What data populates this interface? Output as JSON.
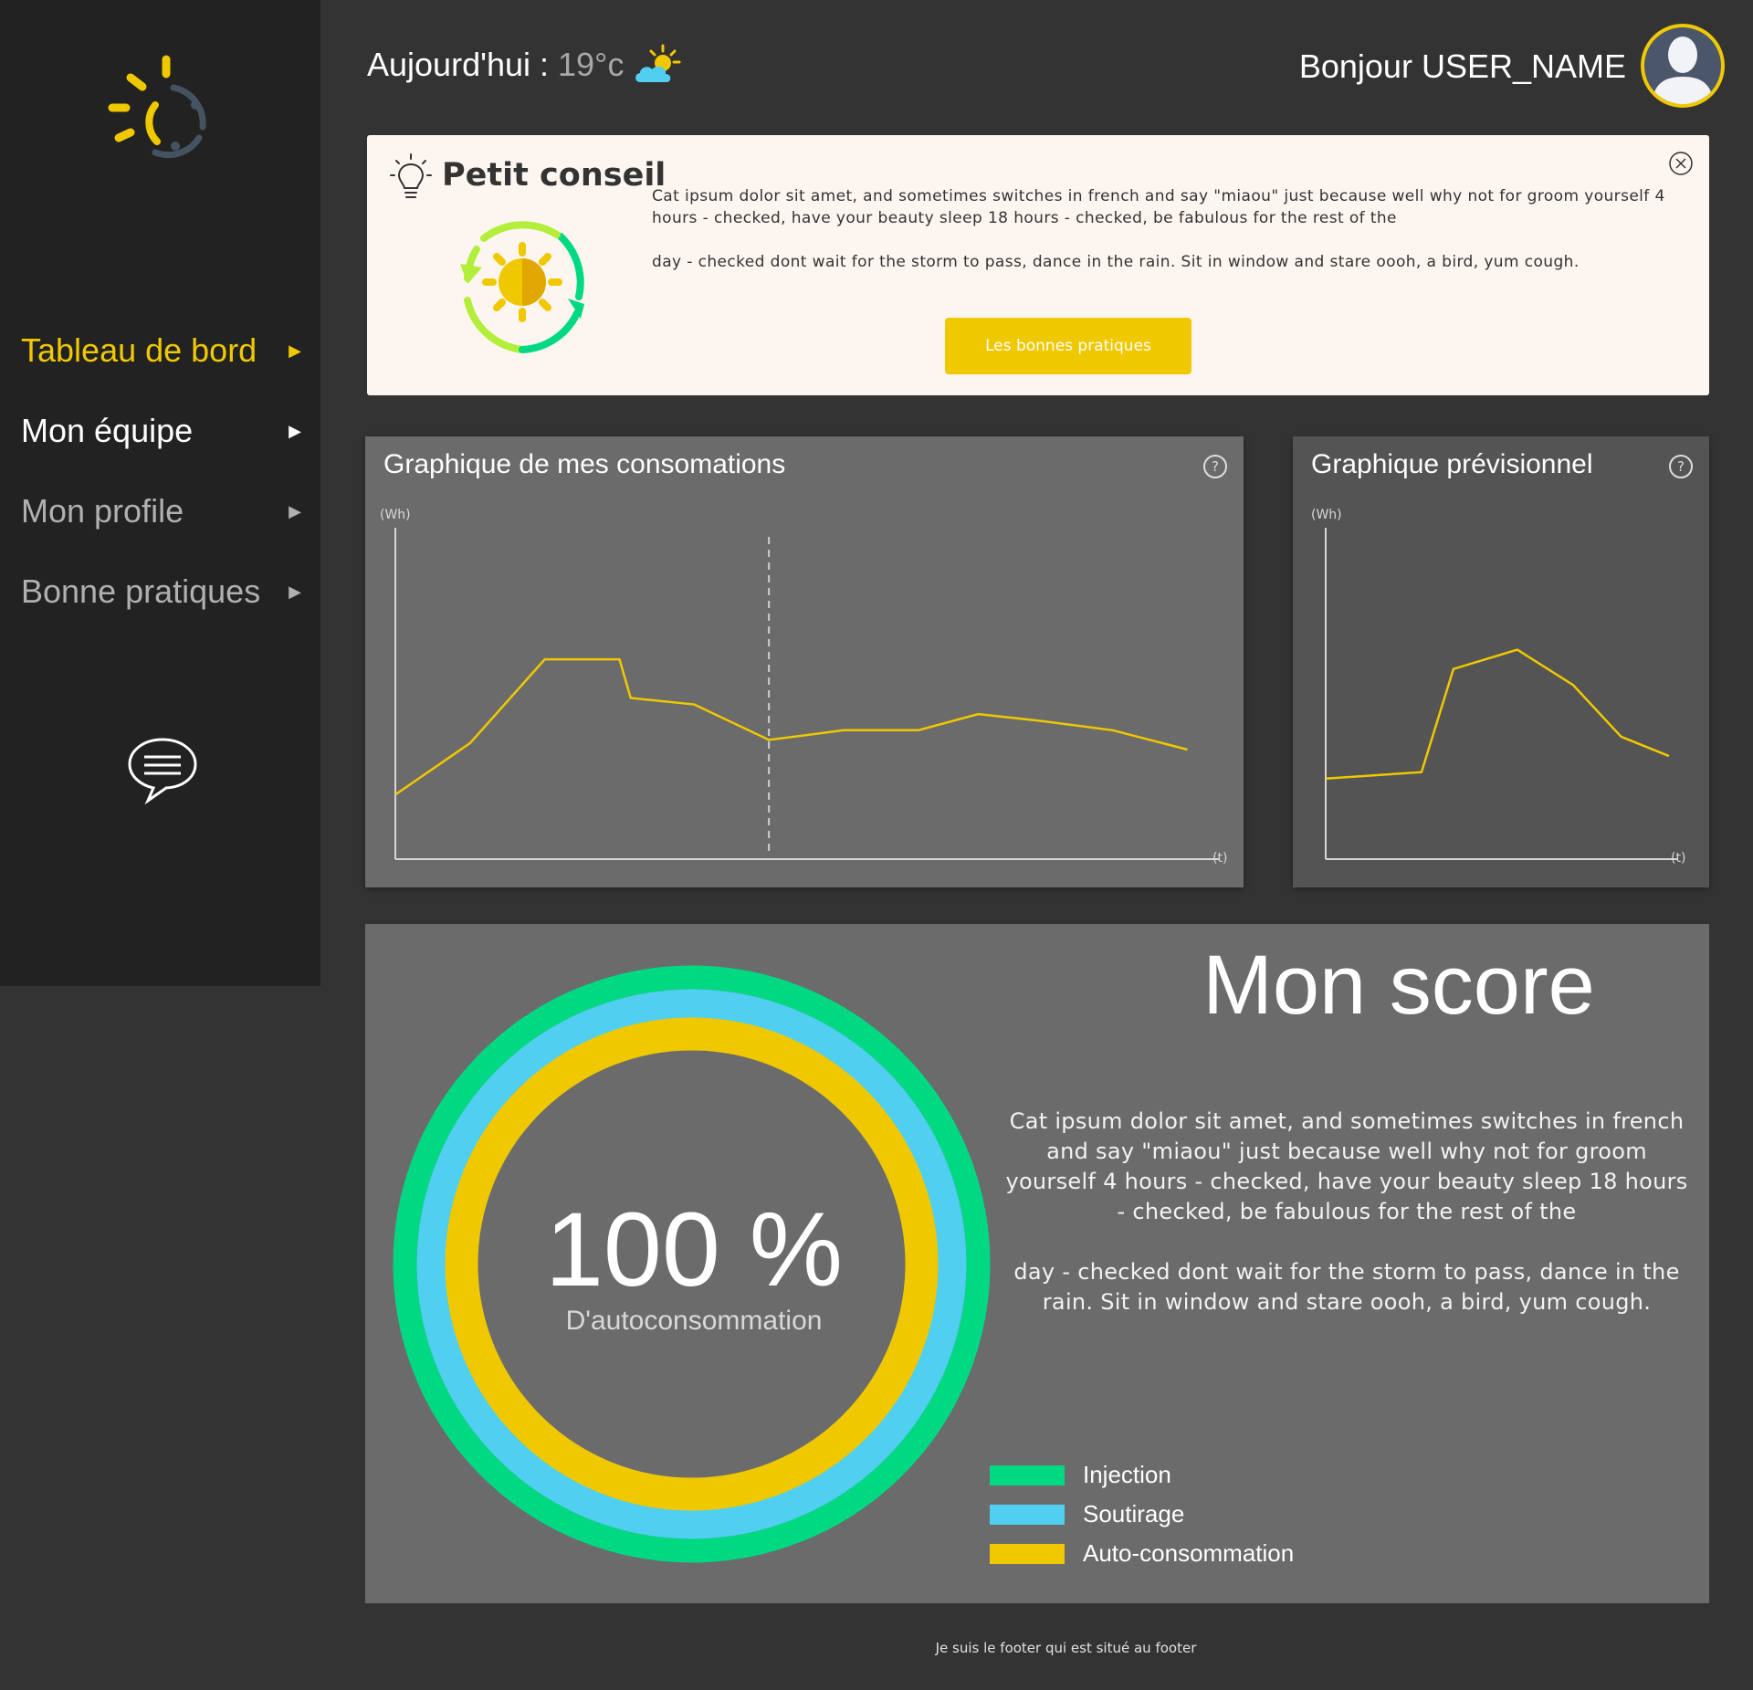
{
  "sidebar": {
    "items": [
      {
        "label": "Tableau de bord",
        "active": true
      },
      {
        "label": "Mon équipe",
        "active": false
      },
      {
        "label": "Mon profile",
        "active": false
      },
      {
        "label": "Bonne pratiques",
        "active": false
      }
    ],
    "arrow": "▶",
    "chat_icon": "chat-bubble-icon"
  },
  "header": {
    "today_label": "Aujourd'hui :",
    "temperature": "19°c",
    "weather_icon": "partly-cloudy-icon",
    "greeting": "Bonjour USER_NAME",
    "avatar_icon": "user-avatar-icon"
  },
  "tip": {
    "title": "Petit conseil",
    "paragraph1": "Cat ipsum dolor sit amet, and sometimes switches in french and say \"miaou\" just because well why not for groom yourself 4 hours - checked, have your beauty sleep 18 hours - checked, be fabulous for the rest of the",
    "paragraph2": "day - checked dont wait for the storm to pass, dance in the rain. Sit in window and stare oooh, a bird, yum cough.",
    "button_label": "Les bonnes pratiques",
    "close_icon": "close-icon"
  },
  "charts": {
    "consumption_title": "Graphique de mes consomations",
    "forecast_title": "Graphique prévisionnel",
    "y_unit": "(Wh)",
    "x_unit": "(t)"
  },
  "chart_data": [
    {
      "type": "line",
      "title": "Graphique de mes consomations",
      "ylabel": "(Wh)",
      "xlabel": "(t)",
      "x": [
        0,
        1,
        2,
        3,
        3.15,
        4,
        5,
        6,
        7,
        7.8,
        8.6,
        9.6,
        10.6
      ],
      "y": [
        20,
        36,
        62,
        62,
        50,
        48,
        37,
        40,
        40,
        45,
        43,
        40,
        34
      ],
      "xlim": [
        0,
        10.9
      ],
      "ylim": [
        0,
        100
      ],
      "marker_x": 5,
      "color": "#f0c800"
    },
    {
      "type": "line",
      "title": "Graphique prévisionnel",
      "ylabel": "(Wh)",
      "xlabel": "(t)",
      "x": [
        0,
        1.2,
        1.6,
        2.4,
        3.1,
        3.7,
        4.3
      ],
      "y": [
        25,
        27,
        59,
        65,
        54,
        38,
        32
      ],
      "xlim": [
        0,
        4.3
      ],
      "ylim": [
        0,
        100
      ],
      "color": "#f0c800"
    }
  ],
  "score": {
    "title": "Mon score",
    "percent": "100 %",
    "percent_label": "D'autoconsommation",
    "paragraph1": "Cat ipsum dolor sit amet, and sometimes switches in french and say \"miaou\" just because well why not for groom yourself 4 hours - checked, have your beauty sleep 18 hours - checked, be fabulous for the rest of the",
    "paragraph2": "day - checked dont wait for the storm to pass, dance in the rain. Sit in window and stare oooh, a bird, yum cough.",
    "legend": [
      {
        "label": "Injection",
        "color": "#00d982"
      },
      {
        "label": "Soutirage",
        "color": "#50cff0"
      },
      {
        "label": "Auto-consommation",
        "color": "#f0c800"
      }
    ]
  },
  "footer": {
    "text": "Je suis le footer qui est situé au footer"
  },
  "colors": {
    "accent": "#f0c800",
    "sidebar_bg": "#222222",
    "page_bg": "#333333",
    "card_bg": "#6b6b6b"
  }
}
